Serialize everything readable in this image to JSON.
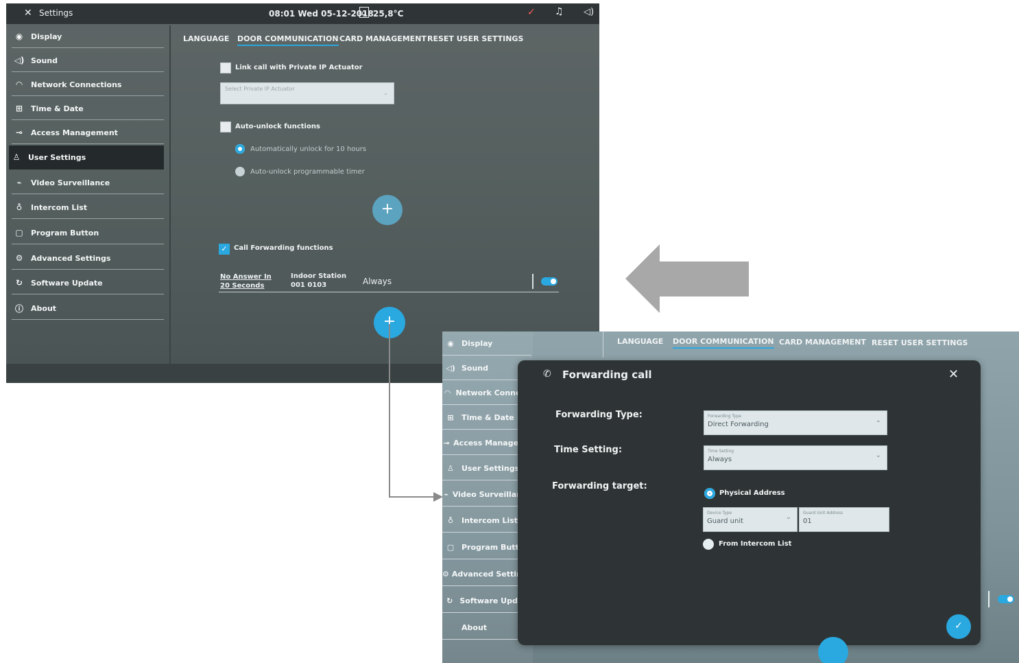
{
  "screen1": {
    "topbar": {
      "close_icon": "close-icon",
      "title": "Settings",
      "datetime": "08:01  Wed 05-12-2018",
      "temperature": "25,8°C"
    },
    "sidebar": [
      {
        "label": "Display",
        "icon": "eye-icon"
      },
      {
        "label": "Sound",
        "icon": "speaker-icon"
      },
      {
        "label": "Network Connections",
        "icon": "wifi-icon"
      },
      {
        "label": "Time & Date",
        "icon": "clock-icon"
      },
      {
        "label": "Access Management",
        "icon": "key-icon"
      },
      {
        "label": "User Settings",
        "icon": "user-icon",
        "active": true
      },
      {
        "label": "Video Surveillance",
        "icon": "camera-icon"
      },
      {
        "label": "Intercom List",
        "icon": "microphone-icon"
      },
      {
        "label": "Program Button",
        "icon": "square-icon"
      },
      {
        "label": "Advanced Settings",
        "icon": "gear-icon"
      },
      {
        "label": "Software Update",
        "icon": "refresh-icon"
      },
      {
        "label": "About",
        "icon": "info-icon"
      }
    ],
    "tabs": [
      "LANGUAGE",
      "DOOR COMMUNICATION",
      "CARD MANAGEMENT",
      "RESET USER SETTINGS"
    ],
    "selected_tab": "DOOR COMMUNICATION",
    "link_call": {
      "label": "Link call with Private IP Actuator",
      "checked": false,
      "select_placeholder": "Select Private IP Actuator"
    },
    "auto_unlock": {
      "label": "Auto-unlock functions",
      "checked": false,
      "options": [
        "Automatically unlock for 10 hours",
        "Auto-unlock programmable timer"
      ],
      "selected_option": "Automatically unlock for 10 hours"
    },
    "add_button_label": "+",
    "call_forwarding": {
      "label": "Call Forwarding functions",
      "checked": true,
      "row": {
        "condition": "No Answer In 20 Seconds",
        "target_line1": "Indoor Station",
        "target_line2": "001 0103",
        "time": "Always",
        "enabled": true
      }
    },
    "add_button2_label": "+"
  },
  "screen2": {
    "sidebar": [
      {
        "label": "Display",
        "icon": "eye-icon"
      },
      {
        "label": "Sound",
        "icon": "speaker-icon"
      },
      {
        "label": "Network Connecti",
        "icon": "wifi-icon"
      },
      {
        "label": "Time & Date",
        "icon": "clock-icon"
      },
      {
        "label": "Access Manageme",
        "icon": "key-icon"
      },
      {
        "label": "User Settings",
        "icon": "user-icon"
      },
      {
        "label": "Video Surveillance",
        "icon": "camera-icon"
      },
      {
        "label": "Intercom List",
        "icon": "microphone-icon"
      },
      {
        "label": "Program Button",
        "icon": "square-icon"
      },
      {
        "label": "Advanced Settings",
        "icon": "gear-icon"
      },
      {
        "label": "Software Update",
        "icon": "refresh-icon"
      },
      {
        "label": "About",
        "icon": "info-icon"
      }
    ],
    "tabs": [
      "LANGUAGE",
      "DOOR COMMUNICATION",
      "CARD MANAGEMENT",
      "RESET USER SETTINGS"
    ],
    "dialog": {
      "title": "Forwarding call",
      "forwarding_type_label": "Forwarding Type:",
      "forwarding_type_small": "Forwarding Type",
      "forwarding_type_value": "Direct Forwarding",
      "time_setting_label": "Time Setting:",
      "time_setting_small": "Time Setting",
      "time_setting_value": "Always",
      "target_label": "Forwarding target:",
      "physical_address": "Physical Address",
      "device_type_small": "Device Type",
      "device_type_value": "Guard unit",
      "guard_address_small": "Guard Unit Address",
      "guard_address_value": "01",
      "from_intercom_list": "From Intercom List",
      "confirm_label": "✓"
    }
  },
  "colors": {
    "accent": "#2aa8e0",
    "arrow": "#a8a8a8"
  }
}
